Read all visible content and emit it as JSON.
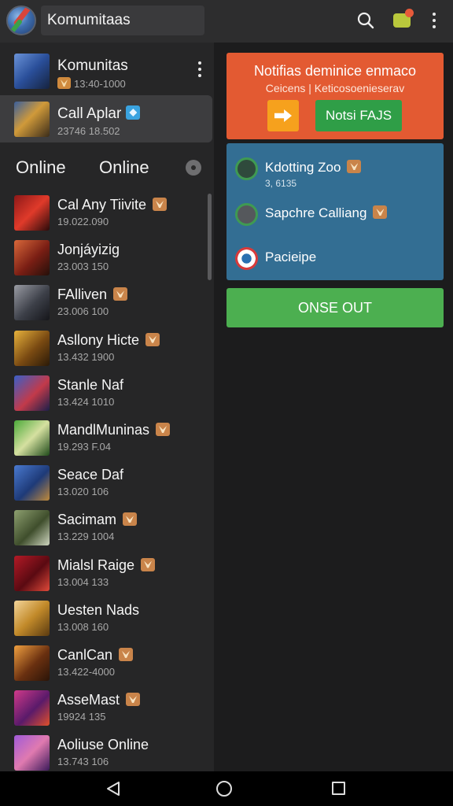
{
  "appbar": {
    "search_value": "Komumitaas"
  },
  "accounts": [
    {
      "name": "Komunitas",
      "meta": "13:40-1000",
      "badge": "gold-small"
    },
    {
      "name": "Call Aplar",
      "meta": "23746 18.502",
      "badge": "blue",
      "selected": true
    }
  ],
  "online_header": {
    "left": "Online",
    "right": "Online"
  },
  "friends": [
    {
      "name": "Cal Any Tiivite",
      "meta": "19.022.090",
      "badge": true
    },
    {
      "name": "Jonjáyizig",
      "meta": "23.003 150",
      "badge": false
    },
    {
      "name": "FAlliven",
      "meta": "23.006 100",
      "badge": true
    },
    {
      "name": "Asllony Hicte",
      "meta": "13.432 1900",
      "badge": true
    },
    {
      "name": "Stanle Naf",
      "meta": "13.424 1010",
      "badge": false
    },
    {
      "name": "MandlMuninas",
      "meta": "19.293 F.04",
      "badge": true
    },
    {
      "name": "Seace Daf",
      "meta": "13.020 106",
      "badge": false
    },
    {
      "name": "Sacimam",
      "meta": "13.229 1004",
      "badge": true
    },
    {
      "name": "Mialsl Raige",
      "meta": "13.004 133",
      "badge": true
    },
    {
      "name": "Uesten Nads",
      "meta": "13.008 160",
      "badge": false
    },
    {
      "name": "CanlCan",
      "meta": "13.422-4000",
      "badge": true
    },
    {
      "name": "AsseMast",
      "meta": "19924 135",
      "badge": true
    },
    {
      "name": "Aoliuse Online",
      "meta": "13.743 106",
      "badge": false
    }
  ],
  "promo": {
    "title": "Notifias deminice enmaco",
    "subtitle": "Ceicens | Keticosoenieserav",
    "button_label": "Notsi FAJS"
  },
  "cards": [
    {
      "name": "Kdotting Zoo",
      "meta": "3, 6135",
      "badge": true
    },
    {
      "name": "Sapchre Calliang",
      "meta": "",
      "badge": true
    },
    {
      "name": "Pacieipe",
      "meta": "",
      "badge": false
    }
  ],
  "sign_out_label": "ONSE OUT",
  "colors": {
    "promo_bg": "#e35a32",
    "promo_button": "#2f9e47",
    "arrow_button": "#f6a11d",
    "card_list_bg": "#336e93",
    "sign_out_bg": "#4caf50",
    "badge": "#c9844a",
    "badge_blue": "#3aa3e0"
  },
  "icons": {
    "appbar": [
      "app-logo-icon",
      "search-icon",
      "cart-icon",
      "more-vert-icon"
    ],
    "navbar": [
      "back-icon",
      "home-icon",
      "recents-icon"
    ]
  }
}
